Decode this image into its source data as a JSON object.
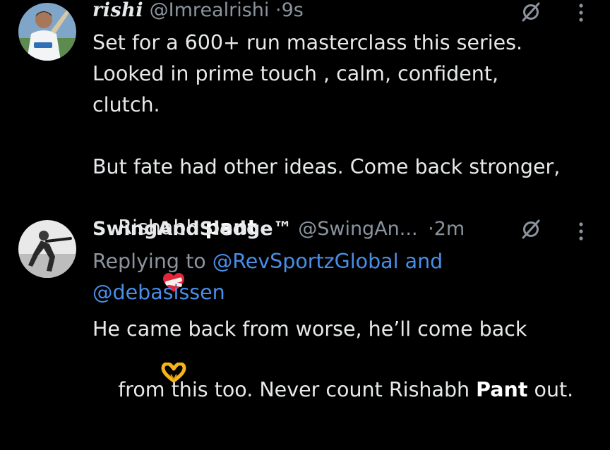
{
  "colors": {
    "background": "#000000",
    "text": "#e7e9ea",
    "muted": "#8b949e",
    "link": "#4a8ee8"
  },
  "tweet1": {
    "display_name": "rishi",
    "handle": "@Imrealrishi",
    "separator": "·",
    "time": "9s",
    "line1": "Set for a 600+ run masterclass this series.",
    "line2": "Looked in prime touch , calm, confident,",
    "line3": "clutch.",
    "line4": "But fate had other ideas. Come back stronger,",
    "line5_prefix": "Rishabh ",
    "line5_bold": "pant",
    "emojis": [
      "mending-heart-emoji",
      "heart-hands-emoji"
    ],
    "icons": [
      "grok-icon",
      "more-options-icon"
    ]
  },
  "tweet2": {
    "display_name": "SwingAndSledge™",
    "handle": "@SwingAn...",
    "separator": "·",
    "time": "2m",
    "replying_prefix": "Replying to ",
    "mention1": "@RevSportzGlobal",
    "and_word": " and",
    "mention2": "@debasissen",
    "line1": "He came back from worse, he’ll come back",
    "line2_prefix": "from this too. Never count Rishabh ",
    "line2_bold": "Pant",
    "line2_suffix": " out.",
    "icons": [
      "grok-icon",
      "more-options-icon"
    ]
  }
}
